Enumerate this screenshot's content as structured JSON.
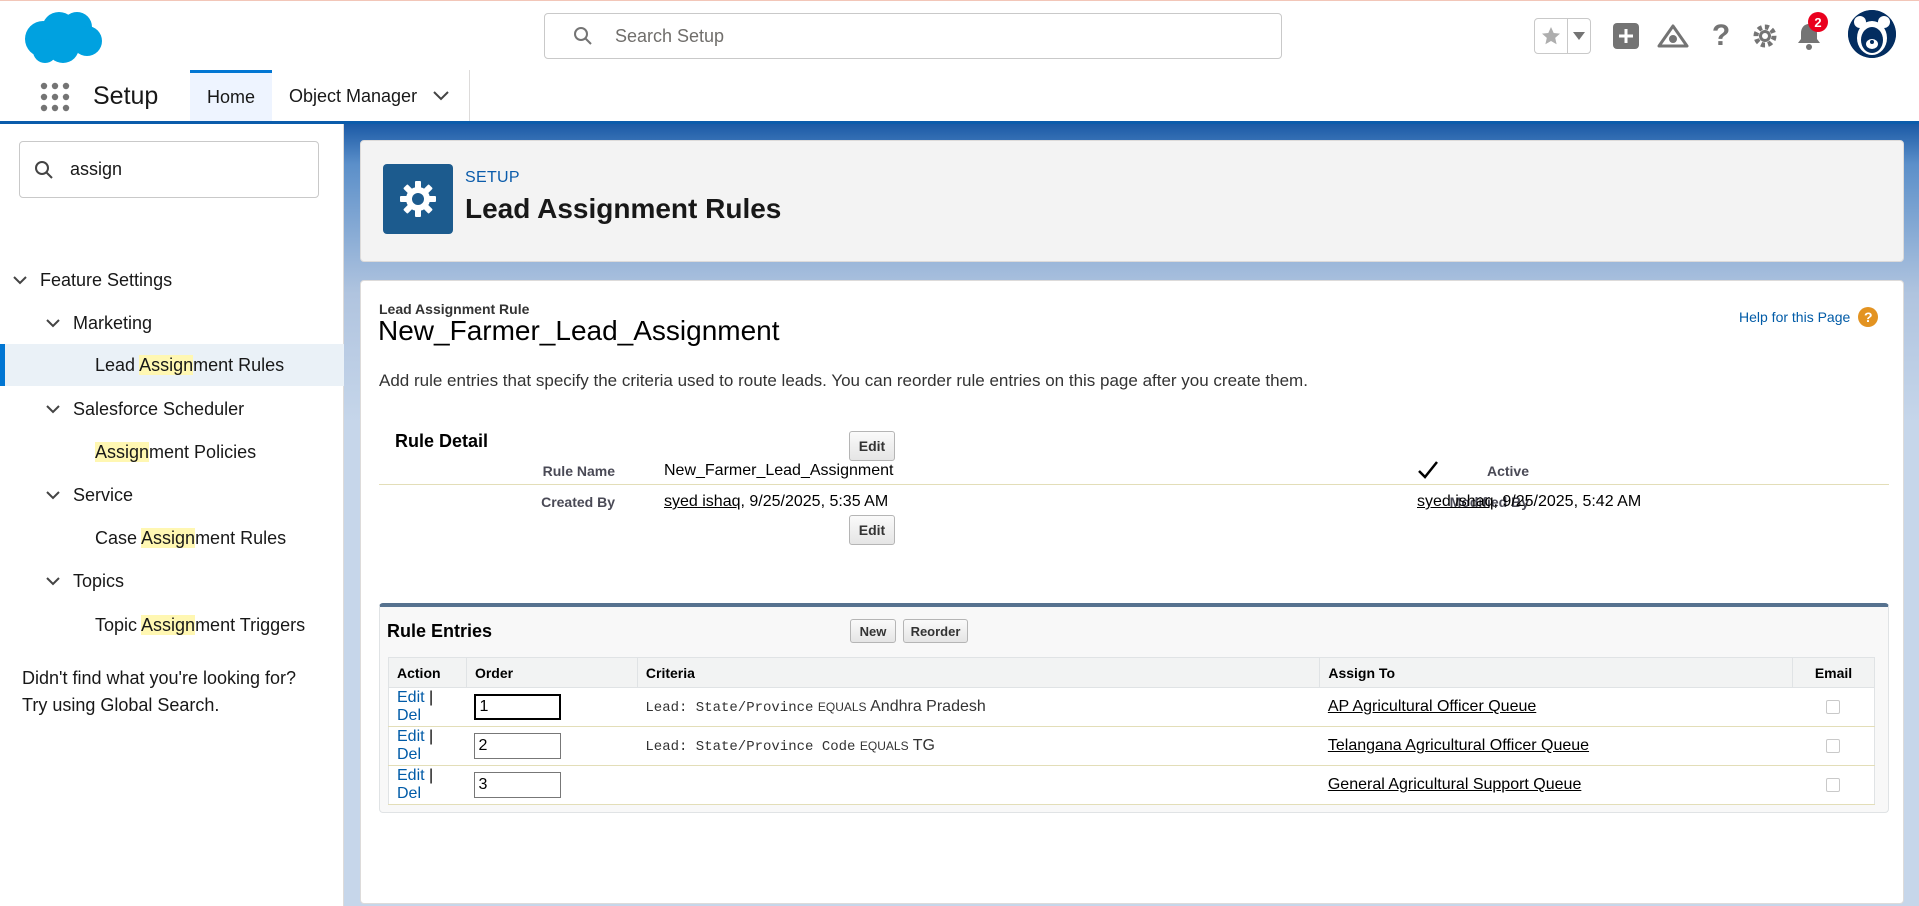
{
  "header": {
    "search_placeholder": "Search Setup",
    "notification_count": "2",
    "icons": [
      "favorites-star-icon",
      "favorites-dropdown-icon",
      "global-actions-plus-icon",
      "trailhead-icon",
      "help-icon",
      "setup-gear-icon",
      "notifications-bell-icon"
    ]
  },
  "nav": {
    "app_name": "Setup",
    "tabs": [
      {
        "label": "Home",
        "active": true
      },
      {
        "label": "Object Manager",
        "active": false
      }
    ]
  },
  "sidebar": {
    "quickfind_value": "assign",
    "tree": [
      {
        "label": "Feature Settings",
        "level": 0,
        "expanded": true
      },
      {
        "label": "Marketing",
        "level": 1,
        "expanded": true
      },
      {
        "pre": "Lead ",
        "match": "Assign",
        "post": "ment Rules",
        "level": 2,
        "selected": true
      },
      {
        "label": "Salesforce Scheduler",
        "level": 1,
        "expanded": true
      },
      {
        "pre": "",
        "match": "Assign",
        "post": "ment Policies",
        "level": 2
      },
      {
        "label": "Service",
        "level": 1,
        "expanded": true
      },
      {
        "pre": "Case ",
        "match": "Assign",
        "post": "ment Rules",
        "level": 2
      },
      {
        "label": "Topics",
        "level": 1,
        "expanded": true
      },
      {
        "pre": "Topic ",
        "match": "Assign",
        "post": "ment Triggers",
        "level": 2
      }
    ],
    "help_line1": "Didn't find what you're looking for?",
    "help_line2": "Try using Global Search."
  },
  "page_header": {
    "eyebrow": "SETUP",
    "title": "Lead Assignment Rules"
  },
  "content": {
    "rule_type_label": "Lead Assignment Rule",
    "rule_name_title": "New_Farmer_Lead_Assignment",
    "help_link": "Help for this Page",
    "intro": "Add rule entries that specify the criteria used to route leads. You can reorder rule entries on this page after you create them.",
    "rule_detail": {
      "title": "Rule Detail",
      "edit_label": "Edit",
      "rule_name_label": "Rule Name",
      "rule_name_value": "New_Farmer_Lead_Assignment",
      "active_label": "Active",
      "active_checked": true,
      "created_by_label": "Created By",
      "created_by_user": "syed ishaq",
      "created_by_date": ", 9/25/2025, 5:35 AM",
      "modified_by_label": "Modified By",
      "modified_by_user": "syed ishaq",
      "modified_by_date": ", 9/25/2025, 5:42 AM"
    },
    "rule_entries": {
      "title": "Rule Entries",
      "new_label": "New",
      "reorder_label": "Reorder",
      "columns": [
        "Action",
        "Order",
        "Criteria",
        "Assign To",
        "Email"
      ],
      "rows": [
        {
          "edit": "Edit",
          "del": "Del",
          "order": "1",
          "criteria_field": "Lead: State/Province",
          "criteria_op": "EQUALS",
          "criteria_value": "Andhra Pradesh",
          "assign_to": "AP Agricultural Officer Queue",
          "email": false
        },
        {
          "edit": "Edit",
          "del": "Del",
          "order": "2",
          "criteria_field": "Lead: State/Province Code",
          "criteria_op": "EQUALS",
          "criteria_value": "TG",
          "assign_to": "Telangana Agricultural Officer Queue",
          "email": false
        },
        {
          "edit": "Edit",
          "del": "Del",
          "order": "3",
          "criteria_field": "",
          "criteria_op": "",
          "criteria_value": "",
          "assign_to": "General Agricultural Support Queue",
          "email": false
        }
      ]
    }
  },
  "colors": {
    "brand_blue": "#0176d3",
    "link_blue": "#015ba7",
    "setup_icon_bg": "#1c5b8e",
    "badge_red": "#ea001e",
    "highlight_yellow": "#fff7b2"
  }
}
